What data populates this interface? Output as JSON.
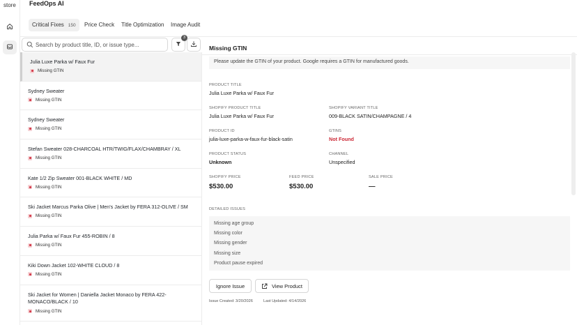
{
  "app": {
    "store_label": "store",
    "title": "FeedOps AI"
  },
  "tabs": [
    {
      "label": "Critical Fixes",
      "count": "150"
    },
    {
      "label": "Price Check"
    },
    {
      "label": "Title Optimization"
    },
    {
      "label": "Image Audit"
    }
  ],
  "search": {
    "placeholder": "Search by product title, ID, or issue type..."
  },
  "filter": {
    "badge": "3"
  },
  "list": [
    {
      "name": "Julia Luxe Parka w/ Faux Fur",
      "issue": "Missing GTIN"
    },
    {
      "name": "Sydney Sweater",
      "issue": "Missing GTIN"
    },
    {
      "name": "Sydney Sweater",
      "issue": "Missing GTIN"
    },
    {
      "name": "Stefan Sweater 028-CHARCOAL HTR/TWIG/FLAX/CHAMBRAY / XL",
      "issue": "Missing GTIN"
    },
    {
      "name": "Kate 1/2 Zip Sweater 001-BLACK WHITE / MD",
      "issue": "Missing GTIN"
    },
    {
      "name": "Ski Jacket Marcus Parka Olive | Men's Jacket by FERA 312-OLIVE / SM",
      "issue": "Missing GTIN"
    },
    {
      "name": "Julia Parka w/ Faux Fur 455-ROBIN / 8",
      "issue": "Missing GTIN"
    },
    {
      "name": "Kiki Down Jacket 102-WHITE CLOUD / 8",
      "issue": "Missing GTIN"
    },
    {
      "name": "Ski Jacket for Women | Daniella Jacket Monaco by FERA 422-MONACO/BLACK / 10",
      "issue": "Missing GTIN"
    }
  ],
  "detail": {
    "title": "Missing GTIN",
    "note": "Please update the GTIN of your product. Google requires a GTIN for manufactured goods.",
    "product_title_label": "PRODUCT TITLE",
    "product_title": "Julia Luxe Parka w/ Faux Fur",
    "shopify_product_title_label": "SHOPIFY PRODUCT TITLE",
    "shopify_product_title": "Julia Luxe Parka w/ Faux Fur",
    "shopify_variant_title_label": "SHOPIFY VARIANT TITLE",
    "shopify_variant_title": "009-BLACK SATIN/CHAMPAGNE / 4",
    "product_id_label": "PRODUCT ID",
    "product_id": "julia-luxe-parka-w-faux-fur-black-satin",
    "gtins_label": "GTINS",
    "gtins": "Not Found",
    "product_status_label": "PRODUCT STATUS",
    "product_status": "Unknown",
    "channel_label": "CHANNEL",
    "channel": "Unspecified",
    "shopify_price_label": "SHOPIFY PRICE",
    "shopify_price": "$530.00",
    "feed_price_label": "FEED PRICE",
    "feed_price": "$530.00",
    "sale_price_label": "SALE PRICE",
    "sale_price": "—",
    "detailed_issues_label": "DETAILED ISSUES",
    "issues": [
      "Missing age group",
      "Missing color",
      "Missing gender",
      "Missing size",
      "Product pause expired"
    ],
    "ignore_button": "Ignore Issue",
    "view_button": "View Product",
    "issue_created": "Issue Created: 3/20/2026",
    "last_updated": "Last Updated: 4/14/2026"
  },
  "colors": {
    "error": "#cc2936",
    "tag_bg": "#f5d0d3",
    "panel_bg": "#f6f6f6"
  }
}
